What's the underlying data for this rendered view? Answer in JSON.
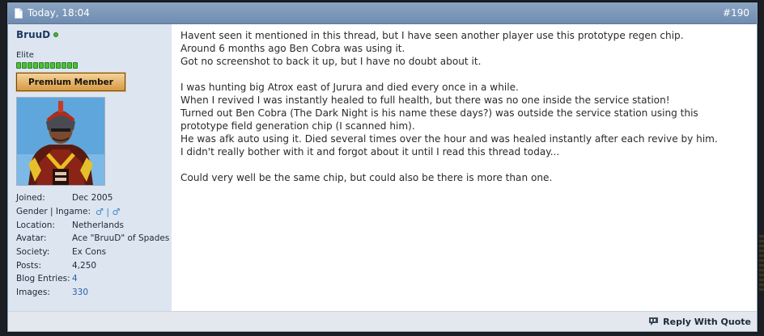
{
  "post": {
    "date": "Today, 18:04",
    "number": "#190"
  },
  "user": {
    "name": "BruuD",
    "status": "online",
    "title": "Elite",
    "reputation_pips": 11,
    "badge": "Premium Member",
    "avatar_icon": "avatar-image",
    "info": [
      {
        "label": "Joined:",
        "value": "Dec 2005"
      },
      {
        "label": "Gender | Ingame:",
        "value": "♂ | ♂"
      },
      {
        "label": "Location:",
        "value": "Netherlands"
      },
      {
        "label": "Avatar:",
        "value": "Ace \"BruuD\" of Spades"
      },
      {
        "label": "Society:",
        "value": "Ex Cons"
      },
      {
        "label": "Posts:",
        "value": "4,250"
      },
      {
        "label": "Blog Entries:",
        "value": "4"
      },
      {
        "label": "Images:",
        "value": "330"
      }
    ]
  },
  "message": {
    "paragraphs": [
      "Havent seen it mentioned in this thread, but I have seen another player use this prototype regen chip.\nAround 6 months ago Ben Cobra was using it.\nGot no screenshot to back it up, but I have no doubt about it.",
      "I was hunting big Atrox east of Jurura and died every once in a while.\nWhen I revived I was instantly healed to full health, but there was no one inside the service station!\nTurned out Ben Cobra (The Dark Night is his name these days?) was outside the service station using this prototype field generation chip (I scanned him).\nHe was afk auto using it. Died several times over the hour and was healed instantly after each revive by him.\nI didn't really bother with it and forgot about it until I read this thread today...",
      "Could very well be the same chip, but could also be there is more than one."
    ]
  },
  "footer": {
    "reply_with_quote": "Reply With Quote"
  },
  "colors": {
    "header": "#7e9aba",
    "user_panel": "#dde5f0",
    "link": "#2a5fa8",
    "online": "#4cb23a"
  }
}
